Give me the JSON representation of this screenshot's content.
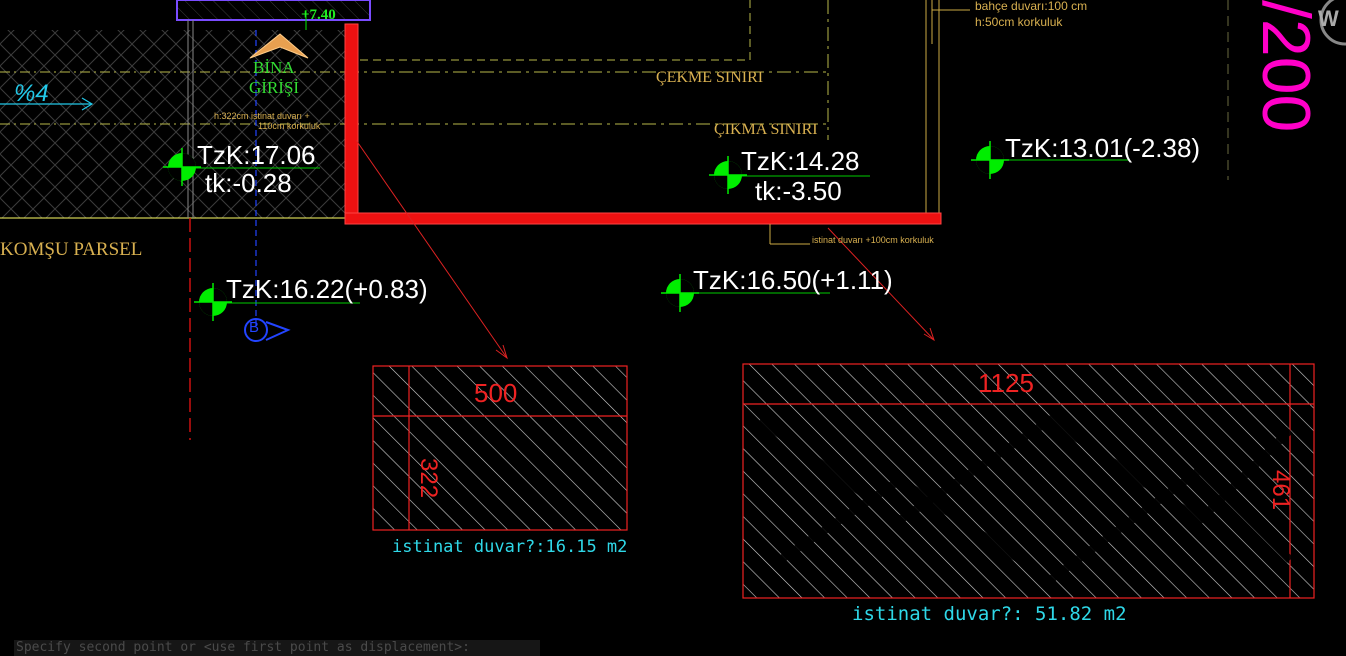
{
  "colors": {
    "background": "#000000",
    "wall_red": "#ff2a2a",
    "elevation_text": "#ffffff",
    "marker_green": "#00ff00",
    "area_text": "#2fd8e8",
    "label_tan": "#d8b050",
    "scale_magenta": "#ff00c8",
    "entrance_green": "#33dd33",
    "level_green": "#22ee22"
  },
  "labels": {
    "entrance_line1": "BİNA",
    "entrance_line2": "GİRİŞİ",
    "level_mark": "+7.40",
    "neighbor": "KOMŞU PARSEL",
    "setback": "ÇEKME SINIRI",
    "projection": "ÇIKMA SINIRI",
    "garden_wall_line1": "bahçe  duvarı:100 cm",
    "garden_wall_line2": "h:50cm korkuluk",
    "wall_note_line1": "h:322cm istinat duvarı +",
    "wall_note_line2": "110cm korkuluk",
    "wall_note_bottom": "istinat duvarı +100cm korkuluk",
    "slope": "%4",
    "scale_fragment": "/200",
    "view_marker": "B",
    "corner_glyph": "W"
  },
  "elevations": [
    {
      "id": "tzk-17-06",
      "tzk": "TzK:17.06",
      "tk": "tk:-0.28"
    },
    {
      "id": "tzk-14-28",
      "tzk": "TzK:14.28",
      "tk": "tk:-3.50"
    },
    {
      "id": "tzk-13-01",
      "tzk": "TzK:13.01(-2.38)"
    },
    {
      "id": "tzk-16-22",
      "tzk": "TzK:16.22(+0.83)"
    },
    {
      "id": "tzk-16-50",
      "tzk": "TzK:16.50(+1.11)"
    }
  ],
  "detail_small": {
    "width": "500",
    "height": "322",
    "area": "istinat  duvar?:16.15  m2"
  },
  "detail_large": {
    "width": "1125",
    "height": "461",
    "area": "istinat  duvar?:  51.82  m2"
  },
  "command_line": "Specify second point or <use first point as displacement>:"
}
